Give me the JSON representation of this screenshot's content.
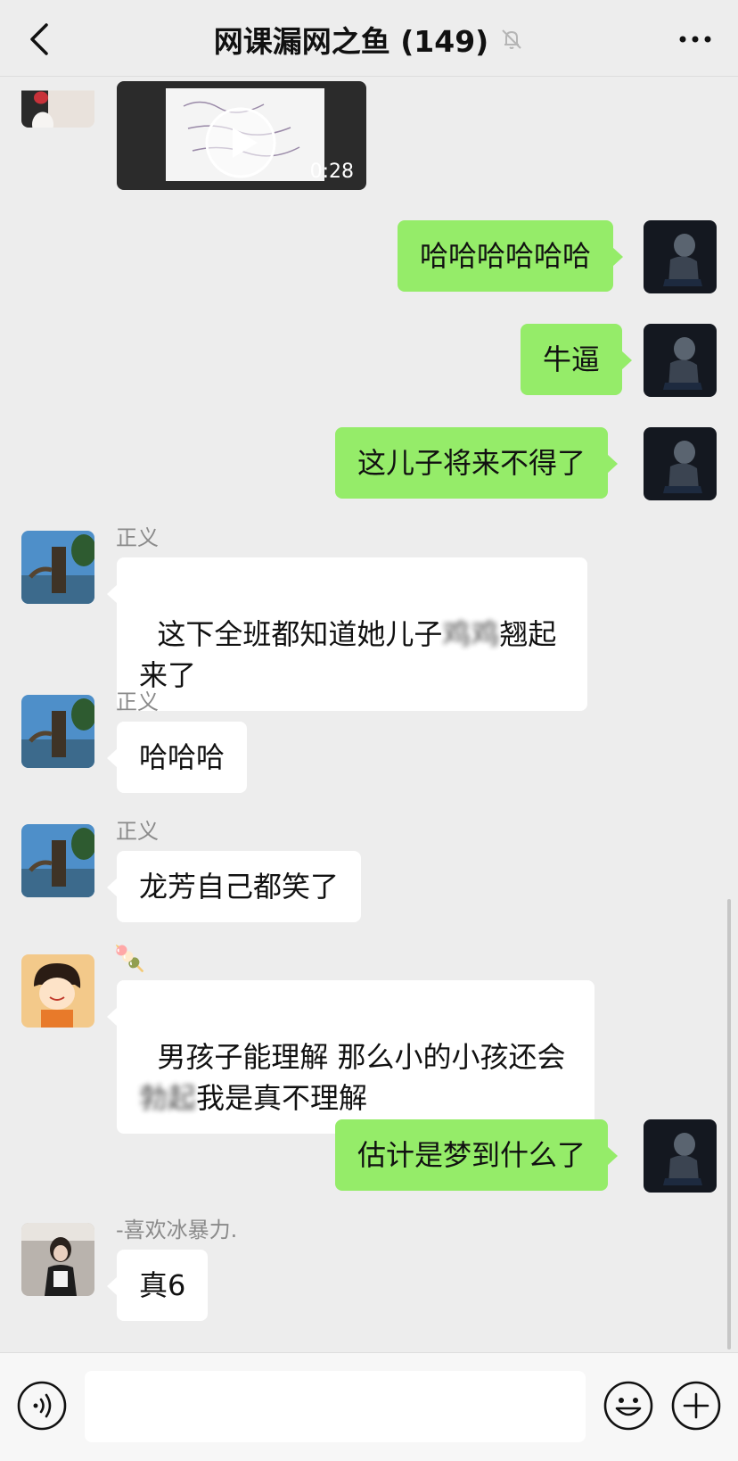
{
  "header": {
    "title": "网课漏网之鱼 (149)",
    "back_icon": "chevron-left-icon",
    "mute_icon": "bell-muted-icon",
    "more_icon": "more-dots-icon"
  },
  "video_message": {
    "duration": "0:28"
  },
  "messages": [
    {
      "side": "right",
      "text": "哈哈哈哈哈哈"
    },
    {
      "side": "right",
      "text": "牛逼"
    },
    {
      "side": "right",
      "text": "这儿子将来不得了"
    },
    {
      "side": "left",
      "sender": "正义",
      "text_line1_a": "这下全班都知道她儿子",
      "text_line1_blur": "鸡鸡",
      "text_line1_b": "翘起",
      "text_line2": "来了"
    },
    {
      "side": "left",
      "sender": "正义",
      "text": "哈哈哈"
    },
    {
      "side": "left",
      "sender": "正义",
      "text": "龙芳自己都笑了"
    },
    {
      "side": "left",
      "sender": "🍡",
      "text_line1": "男孩子能理解 那么小的小孩还会",
      "text_line2_blur": "勃起",
      "text_line2_b": "我是真不理解"
    },
    {
      "side": "right",
      "text": "估计是梦到什么了"
    },
    {
      "side": "left",
      "sender": "-喜欢冰暴力.",
      "text": "真6"
    }
  ],
  "input_bar": {
    "voice_icon": "voice-icon",
    "emoji_icon": "emoji-icon",
    "plus_icon": "plus-icon",
    "input_value": ""
  },
  "colors": {
    "background": "#ededed",
    "self_bubble": "#95ec69",
    "other_bubble": "#ffffff"
  }
}
